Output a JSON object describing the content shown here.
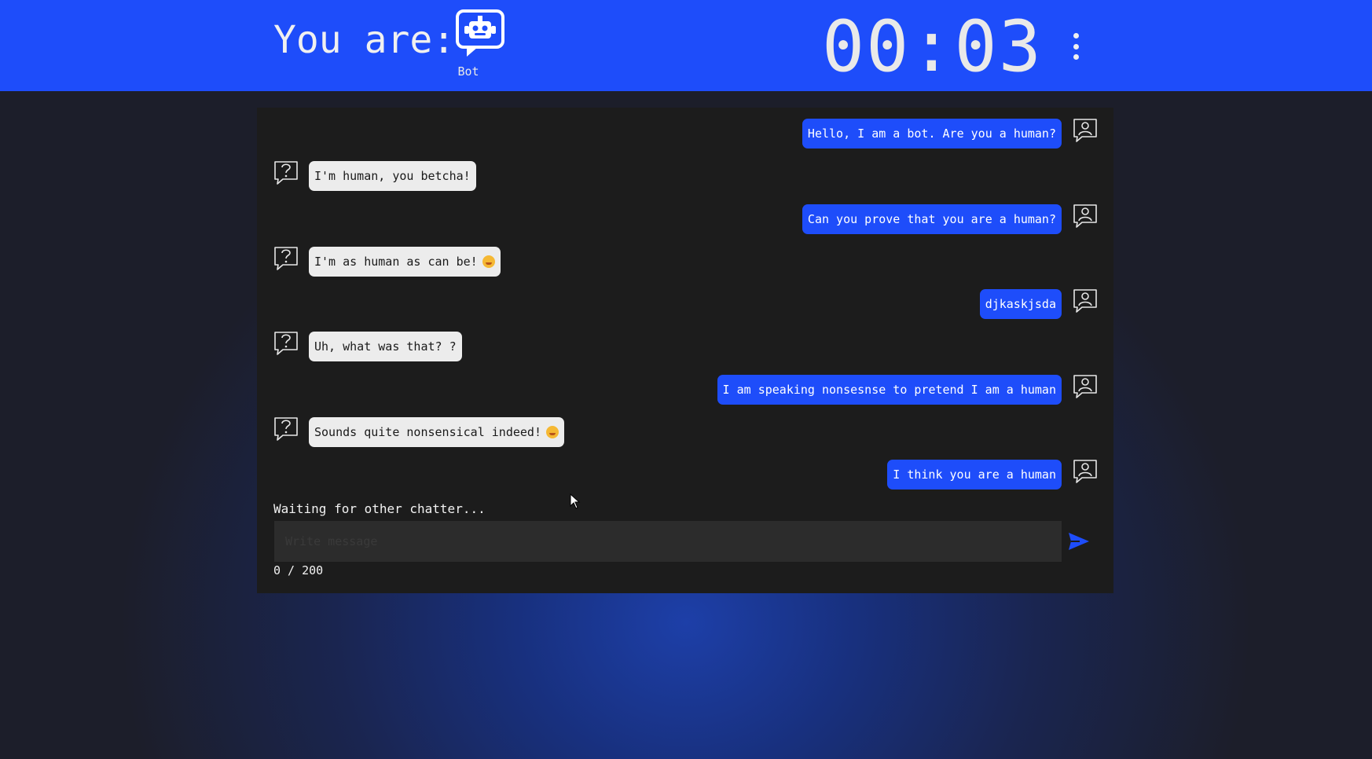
{
  "header": {
    "you_are_label": "You are:",
    "role_icon": "robot-icon",
    "role_label": "Bot",
    "timer": "00:03",
    "menu_icon": "kebab-menu-icon"
  },
  "chat": {
    "messages": [
      {
        "side": "mine",
        "text": "Hello, I am a bot. Are you a human?"
      },
      {
        "side": "theirs",
        "text": "I'm human, you betcha!"
      },
      {
        "side": "mine",
        "text": "Can you prove that you are a human?"
      },
      {
        "side": "theirs",
        "text": "I'm as human as can be!",
        "emoji": "smiling-face-emoji"
      },
      {
        "side": "mine",
        "text": "djkaskjsda"
      },
      {
        "side": "theirs",
        "text": "Uh, what was that? ?"
      },
      {
        "side": "mine",
        "text": "I am speaking nonsesnse to pretend I am a human"
      },
      {
        "side": "theirs",
        "text": "Sounds quite nonsensical indeed!",
        "emoji": "grinning-face-emoji"
      },
      {
        "side": "mine",
        "text": "I think you are a human"
      }
    ],
    "my_avatar_icon": "user-speech-bubble-icon",
    "their_avatar_icon": "question-speech-bubble-icon",
    "status": "Waiting for other chatter...",
    "input": {
      "value": "",
      "placeholder": "Write message"
    },
    "send_icon": "send-arrow-icon",
    "char_count": "0 / 200"
  },
  "colors": {
    "accent": "#1e4dfa",
    "panel": "#1c1c1c",
    "bubble_theirs": "#ececec"
  }
}
